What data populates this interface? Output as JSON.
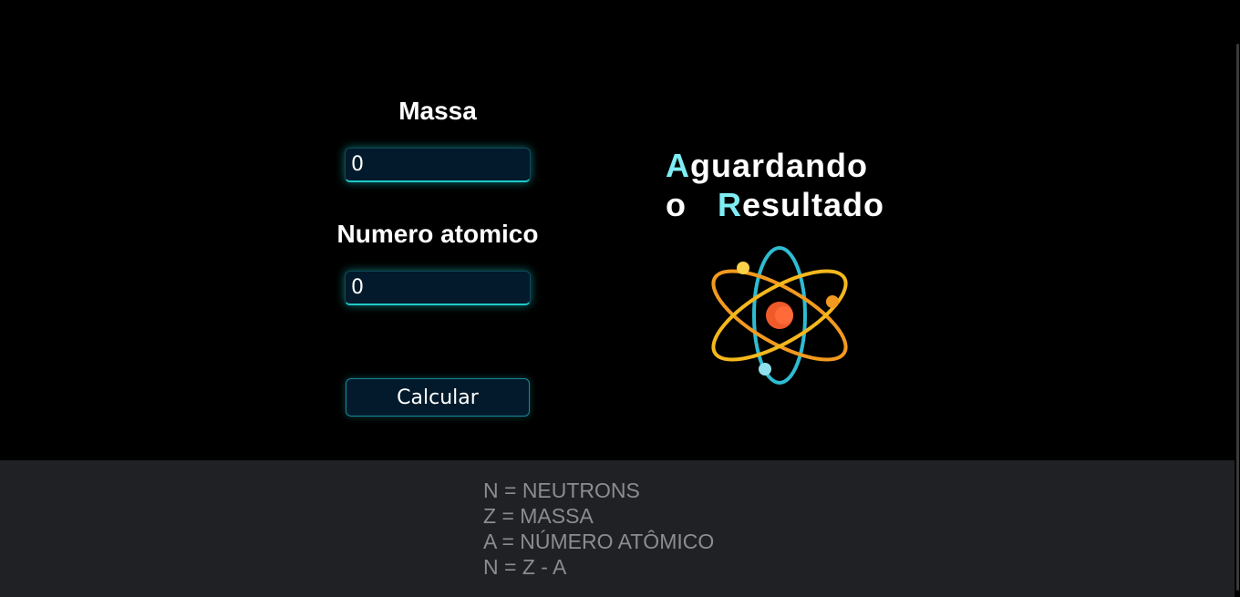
{
  "form": {
    "massa_label": "Massa",
    "massa_value": "0",
    "numero_label": "Numero atomico",
    "numero_value": "0",
    "calcular_label": "Calcular"
  },
  "result": {
    "word1_initial": "A",
    "word1_rest": "guardando",
    "word2": "o",
    "word3_initial": "R",
    "word3_rest": "esultado",
    "accent_color": "#7eeef4"
  },
  "atom_icon": "atom-icon",
  "footer": {
    "lines": [
      "N = NEUTRONS",
      "Z = MASSA",
      "A = NÚMERO ATÔMICO",
      "N = Z - A"
    ]
  },
  "colors": {
    "background": "#000000",
    "footer_background": "#202124",
    "input_glow": "#1fc9c9",
    "footer_text": "#8a8d90"
  }
}
